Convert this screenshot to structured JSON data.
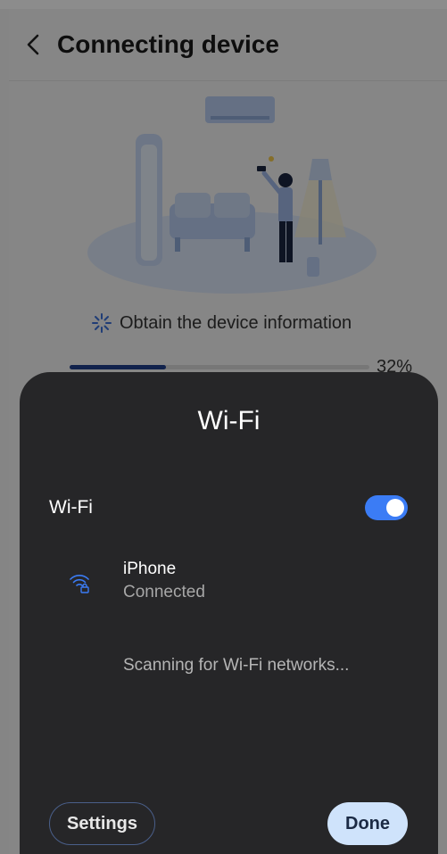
{
  "header": {
    "title": "Connecting device",
    "back_icon": "chevron-left-icon"
  },
  "progress": {
    "status_text": "Obtain the device information",
    "percent_label": "32%",
    "fraction": 0.32,
    "fill_color": "#1f3e8a"
  },
  "wifi_sheet": {
    "title": "Wi-Fi",
    "toggle_label": "Wi-Fi",
    "toggle_on": true,
    "toggle_color": "#3b7cf5",
    "networks": [
      {
        "name": "iPhone",
        "status": "Connected",
        "icon": "wifi-lock-icon"
      }
    ],
    "scanning_text": "Scanning for Wi-Fi networks...",
    "settings_label": "Settings",
    "done_label": "Done"
  }
}
